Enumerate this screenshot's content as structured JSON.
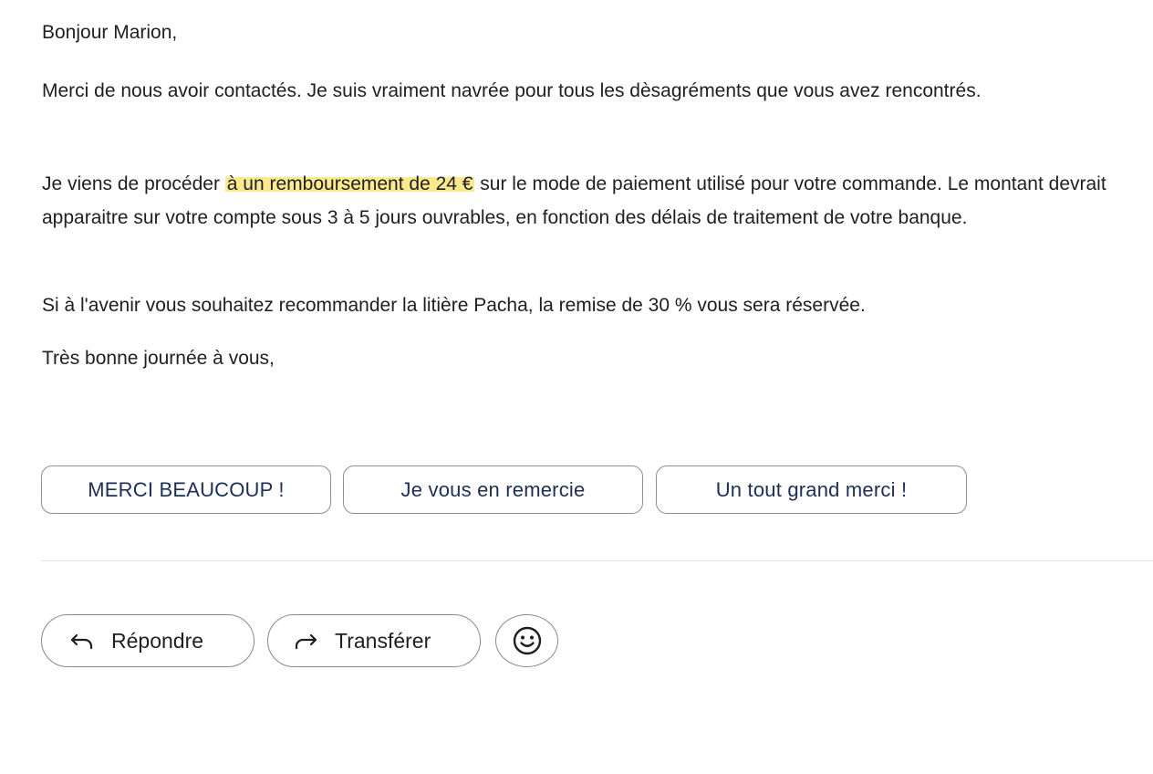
{
  "email": {
    "greeting": "Bonjour Marion,",
    "paragraph_thanks": "Merci de nous avoir contactés. Je suis vraiment navrée pour tous les dèsagréments que vous avez rencontrés.",
    "refund": {
      "before": "Je viens de procéder ",
      "highlight": "à un remboursement de 24 €",
      "after": " sur le mode de paiement utilisé pour votre commande. Le montant devrait apparaitre sur votre compte sous 3 à 5 jours ouvrables, en fonction des délais de traitement de votre banque.",
      "highlight_color": "#fbe98f"
    },
    "paragraph_future": "Si à l'avenir vous souhaitez recommander la litière Pacha, la remise de 30 % vous sera réservée.",
    "closing": "Très bonne journée à vous,"
  },
  "smart_replies": [
    {
      "label": "MERCI BEAUCOUP !"
    },
    {
      "label": "Je vous en remercie"
    },
    {
      "label": "Un tout grand merci !"
    }
  ],
  "actions": {
    "reply": {
      "label": "Répondre",
      "icon": "reply-arrow-icon"
    },
    "forward": {
      "label": "Transférer",
      "icon": "forward-arrow-icon"
    },
    "emoji": {
      "icon": "smiley-face-icon"
    }
  },
  "colors": {
    "chip_text": "#1b2f57",
    "body_text": "#1f1f1f",
    "border": "#8f8f8f"
  }
}
